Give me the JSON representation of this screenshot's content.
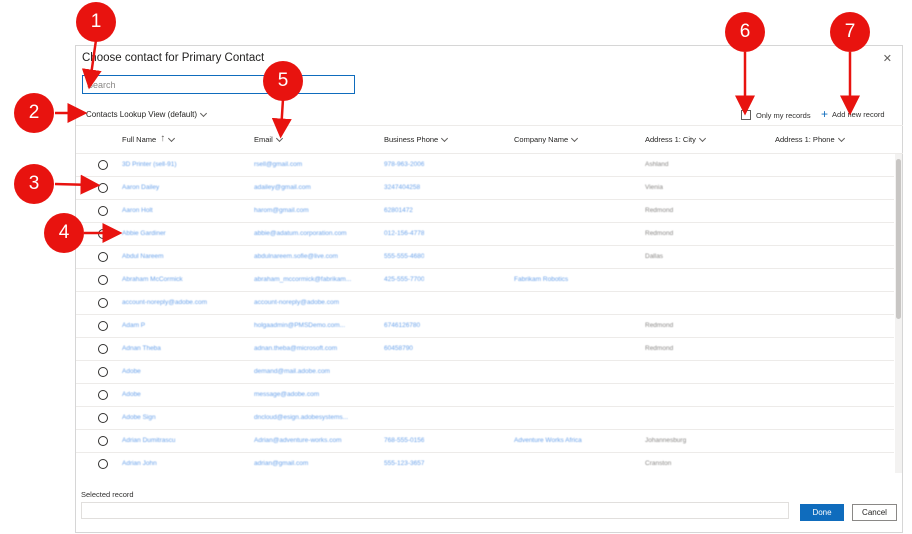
{
  "dialog": {
    "title": "Choose contact for Primary Contact",
    "close_icon": "close-icon"
  },
  "search": {
    "placeholder": "Search",
    "value": ""
  },
  "view_selector": {
    "label": "Contacts Lookup View (default)"
  },
  "only_my_records": {
    "label": "Only my records",
    "checked": false
  },
  "add_new_record": {
    "label": "Add new record"
  },
  "columns": [
    {
      "label": "Full Name",
      "sorted": "ascending"
    },
    {
      "label": "Email"
    },
    {
      "label": "Business Phone"
    },
    {
      "label": "Company Name"
    },
    {
      "label": "Address 1: City"
    },
    {
      "label": "Address 1: Phone"
    }
  ],
  "rows": [
    {
      "name": "3D Printer (sell-91)",
      "email": "rsell@gmail.com",
      "phone": "978-963-2006",
      "company": "",
      "city": "Ashland"
    },
    {
      "name": "Aaron Dailey",
      "email": "adailey@gmail.com",
      "phone": "3247404258",
      "company": "",
      "city": "Vienia"
    },
    {
      "name": "Aaron Holt",
      "email": "harom@gmail.com",
      "phone": "62801472",
      "company": "",
      "city": "Redmond"
    },
    {
      "name": "Abbie Gardiner",
      "email": "abbie@adatum.corporation.com",
      "phone": "012-156-4778",
      "company": "",
      "city": "Redmond"
    },
    {
      "name": "Abdul Nareem",
      "email": "abdulnareem.sofie@live.com",
      "phone": "555-555-4680",
      "company": "",
      "city": "Dallas"
    },
    {
      "name": "Abraham McCormick",
      "email": "abraham_mccormick@fabrikam...",
      "phone": "425-555-7700",
      "company": "Fabrikam Robotics",
      "city": ""
    },
    {
      "name": "account-noreply@adobe.com",
      "email": "account-noreply@adobe.com",
      "phone": "",
      "company": "",
      "city": ""
    },
    {
      "name": "Adam P",
      "email": "holgaadmin@PMSDemo.com...",
      "phone": "6746126780",
      "company": "",
      "city": "Redmond"
    },
    {
      "name": "Adnan Theba",
      "email": "adnan.theba@microsoft.com",
      "phone": "60458790",
      "company": "",
      "city": "Redmond"
    },
    {
      "name": "Adobe",
      "email": "demand@mail.adobe.com",
      "phone": "",
      "company": "",
      "city": ""
    },
    {
      "name": "Adobe",
      "email": "message@adobe.com",
      "phone": "",
      "company": "",
      "city": ""
    },
    {
      "name": "Adobe Sign",
      "email": "dncloud@esign.adobesystems...",
      "phone": "",
      "company": "",
      "city": ""
    },
    {
      "name": "Adrian Dumitrascu",
      "email": "Adrian@adventure-works.com",
      "phone": "768-555-0156",
      "company": "Adventure Works Africa",
      "city": "Johannesburg"
    },
    {
      "name": "Adrian John",
      "email": "adrian@gmail.com",
      "phone": "555-123-3657",
      "company": "",
      "city": "Cranston"
    }
  ],
  "selected_record": {
    "label": "Selected record",
    "value": ""
  },
  "buttons": {
    "done": "Done",
    "cancel": "Cancel"
  },
  "annotations": [
    "1",
    "2",
    "3",
    "4",
    "5",
    "6",
    "7"
  ],
  "colors": {
    "accent": "#0f6cbd",
    "callout": "#e8130f"
  }
}
